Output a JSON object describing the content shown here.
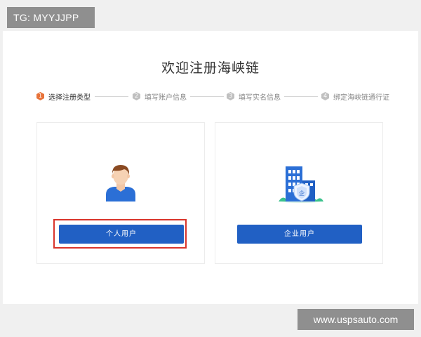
{
  "overlay": {
    "top_tag": "TG: MYYJJPP",
    "bottom_tag": "www.uspsauto.com"
  },
  "page": {
    "title": "欢迎注册海峡链"
  },
  "steps": [
    {
      "num": "1",
      "label": "选择注册类型",
      "active": true
    },
    {
      "num": "2",
      "label": "填写账户信息",
      "active": false
    },
    {
      "num": "3",
      "label": "填写实名信息",
      "active": false
    },
    {
      "num": "4",
      "label": "绑定海峡链通行证",
      "active": false
    }
  ],
  "cards": {
    "personal": {
      "button_label": "个人用户",
      "icon": "person-avatar-icon"
    },
    "enterprise": {
      "button_label": "企业用户",
      "icon": "enterprise-building-icon"
    }
  },
  "colors": {
    "primary_button": "#2160c4",
    "active_step": "#e8733a",
    "highlight_border": "#d9342b",
    "building_blue": "#2b6fd6"
  }
}
